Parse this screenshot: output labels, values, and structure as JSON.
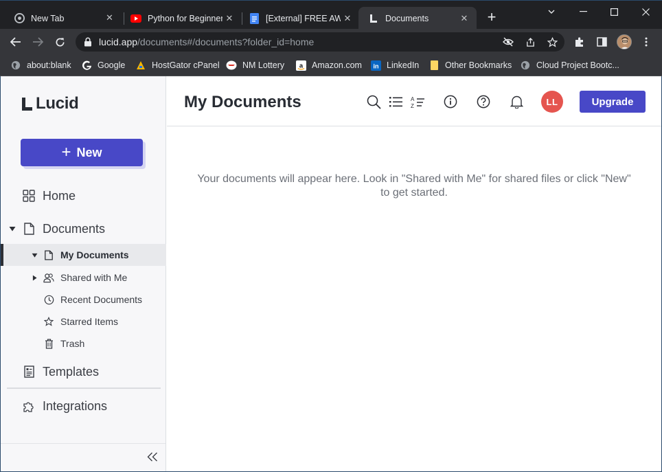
{
  "browser": {
    "tabs": [
      {
        "title": "New Tab",
        "icon": "chrome-icon"
      },
      {
        "title": "Python for Beginners",
        "icon": "youtube-icon"
      },
      {
        "title": "[External] FREE AWS",
        "icon": "google-docs-icon"
      },
      {
        "title": "Documents",
        "icon": "lucid-icon",
        "active": true
      }
    ],
    "url_host": "lucid.app",
    "url_path": "/documents#/documents?folder_id=home",
    "bookmarks": [
      {
        "label": "about:blank",
        "icon": "globe-icon"
      },
      {
        "label": "Google",
        "icon": "google-icon"
      },
      {
        "label": "HostGator cPanel",
        "icon": "hostgator-icon"
      },
      {
        "label": "NM Lottery",
        "icon": "nm-lottery-icon"
      },
      {
        "label": "Amazon.com",
        "icon": "amazon-icon"
      },
      {
        "label": "LinkedIn",
        "icon": "linkedin-icon"
      },
      {
        "label": "Other Bookmarks",
        "icon": "folder-icon"
      },
      {
        "label": "Cloud Project Bootc...",
        "icon": "globe-icon"
      }
    ]
  },
  "app": {
    "logo_text": "Lucid",
    "new_button": "New",
    "nav": {
      "home": "Home",
      "documents": "Documents",
      "sub": {
        "my_documents": "My Documents",
        "shared_with_me": "Shared with Me",
        "recent_documents": "Recent Documents",
        "starred_items": "Starred Items",
        "trash": "Trash"
      },
      "templates": "Templates",
      "integrations": "Integrations"
    },
    "header": {
      "title": "My Documents",
      "avatar_initials": "LL",
      "upgrade": "Upgrade"
    },
    "empty_message": "Your documents will appear here. Look in \"Shared with Me\" for shared files or click \"New\" to get started."
  },
  "colors": {
    "accent": "#4848c7",
    "avatar": "#e5554f",
    "chrome_dark": "#202124",
    "chrome_toolbar": "#35363a"
  }
}
